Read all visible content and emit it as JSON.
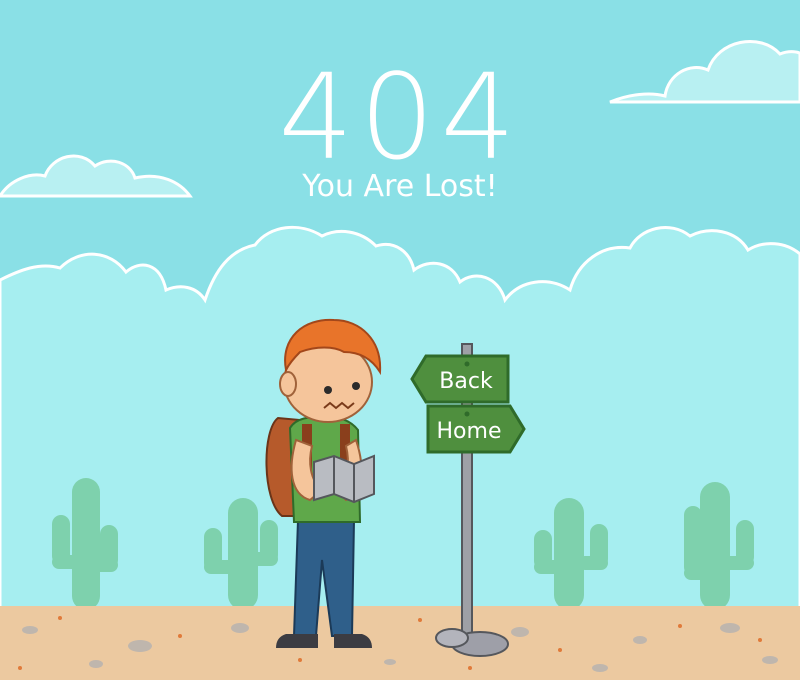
{
  "error": {
    "code": "404",
    "message": "You Are Lost!"
  },
  "signpost": {
    "back_label": "Back",
    "home_label": "Home"
  },
  "colors": {
    "sky": "#8ae0e6",
    "sky_cloud_band": "#a6eef0",
    "cloud_white": "#c9f6f6",
    "ground": "#ecc9a0",
    "cactus": "#7ed1ad",
    "sign_green": "#4f8f3e",
    "sign_border": "#2f6b2a",
    "hair": "#e8742a",
    "shirt": "#5fa84a",
    "jeans": "#2f5f8a",
    "backpack": "#b65a2b"
  }
}
